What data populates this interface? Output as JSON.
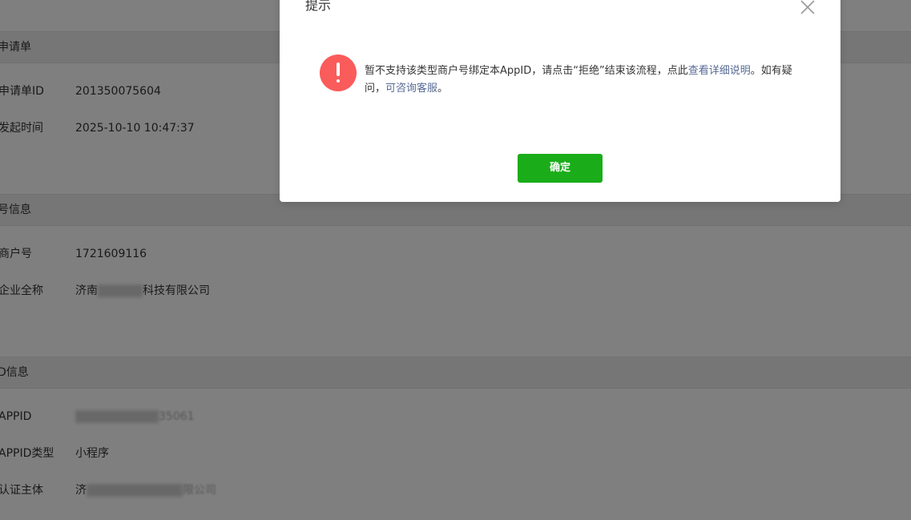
{
  "sections": {
    "apply": {
      "header": "申请单",
      "fields": [
        {
          "label": "申请单ID",
          "value": "201350075604"
        },
        {
          "label": "发起时间",
          "value": "2025-10-10 10:47:37"
        }
      ]
    },
    "merchant": {
      "header": "号信息",
      "fields": [
        {
          "label": "商户号",
          "value": "1721609116"
        },
        {
          "label": "企业全称",
          "value_prefix": "济南",
          "value_suffix": "科技有限公司"
        }
      ]
    },
    "appid": {
      "header": "D信息",
      "fields": [
        {
          "label": "APPID",
          "value_suffix": "35061"
        },
        {
          "label": "APPID类型",
          "value": "小程序"
        },
        {
          "label": "认证主体",
          "value_prefix": "济",
          "value_suffix": "限公司"
        }
      ]
    }
  },
  "dialog": {
    "title": "提示",
    "message_part1": "暂不支持该类型商户号绑定本AppID，请点击“拒绝”结束该流程，点此",
    "link_details": "查看详细说明",
    "message_part2": "。如有疑问，",
    "link_support": "可咨询客服",
    "message_part3": "。",
    "confirm_label": "确定",
    "close_icon": "close-icon",
    "alert_icon": "warning-icon"
  },
  "colors": {
    "accent_green": "#1aad19",
    "link_blue": "#576b95",
    "alert_red": "#fa5b5b",
    "overlay": "rgba(0,0,0,0.5)"
  }
}
